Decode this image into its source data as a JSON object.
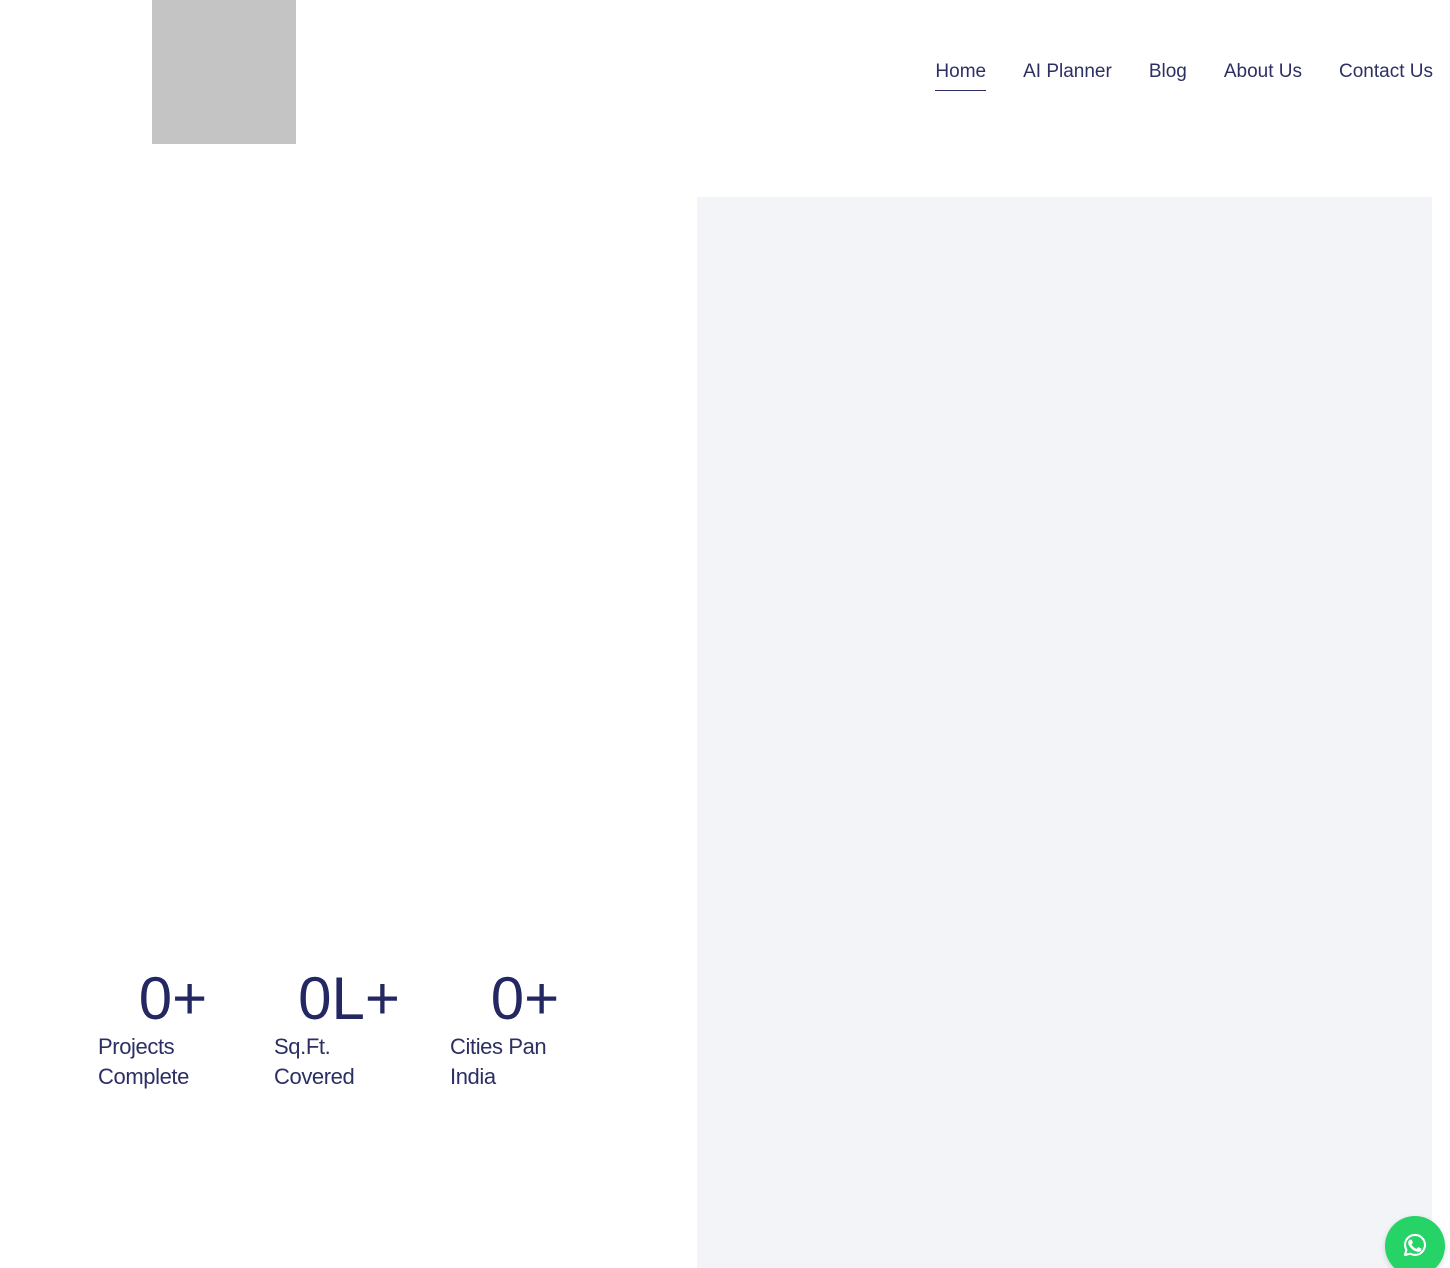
{
  "header": {
    "logo_alt": "",
    "nav": [
      {
        "label": "Home",
        "active": true
      },
      {
        "label": "AI Planner",
        "active": false
      },
      {
        "label": "Blog",
        "active": false
      },
      {
        "label": "About Us",
        "active": false
      },
      {
        "label": "Contact Us",
        "active": false
      }
    ]
  },
  "stats": [
    {
      "value": "0+",
      "label": "Projects Complete"
    },
    {
      "value": "0L+",
      "label": "Sq.Ft. Covered"
    },
    {
      "value": "0+",
      "label": "Cities Pan India"
    }
  ],
  "floating": {
    "icon": "whatsapp-icon",
    "color": "#25d366"
  },
  "colors": {
    "text": "#2c2f64",
    "stat_value": "#232863",
    "panel_bg": "#f3f4f8",
    "logo_placeholder": "#c4c4c4"
  }
}
